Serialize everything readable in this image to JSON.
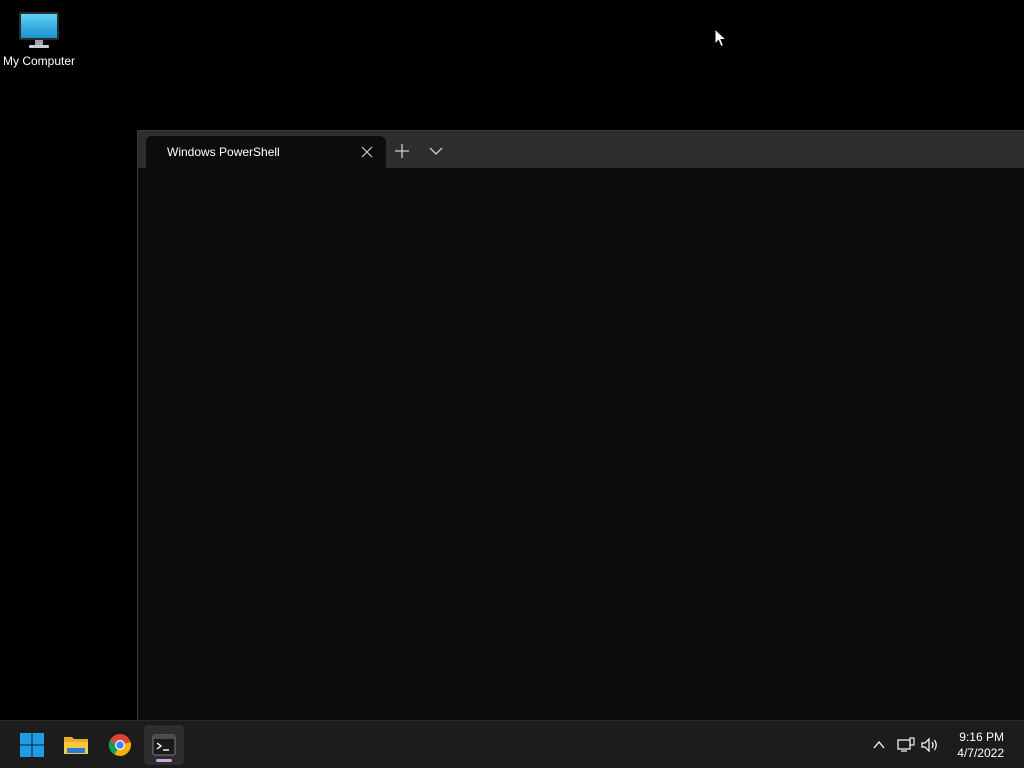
{
  "desktop": {
    "icons": [
      {
        "label": "My Computer",
        "icon": "monitor-icon"
      }
    ],
    "background_color": "#000000"
  },
  "terminal": {
    "tabs": [
      {
        "title": "Windows PowerShell",
        "active": true
      }
    ],
    "new_tab_icon": "plus-icon",
    "dropdown_icon": "chevron-down-icon",
    "background_color": "#0c0c0c",
    "tabbar_color": "#2e2e2e"
  },
  "taskbar": {
    "apps": [
      {
        "name": "start",
        "icon": "windows-logo-icon"
      },
      {
        "name": "file-explorer",
        "icon": "folder-icon"
      },
      {
        "name": "chrome",
        "icon": "chrome-icon"
      },
      {
        "name": "terminal",
        "icon": "terminal-icon",
        "active": true
      }
    ],
    "tray": {
      "icons": [
        "chevron-up-icon",
        "network-icon",
        "volume-icon"
      ]
    },
    "clock": {
      "time": "9:16 PM",
      "date": "4/7/2022"
    },
    "accent_indicator_color": "#c9a6e6"
  }
}
